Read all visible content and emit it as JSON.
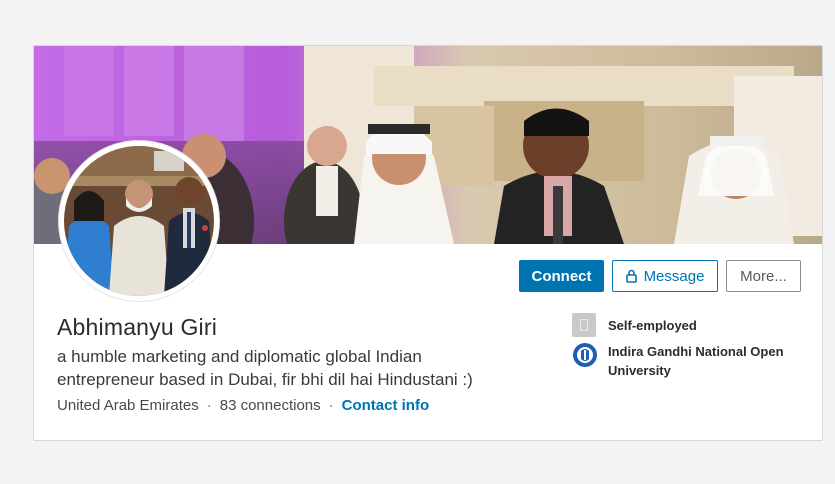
{
  "profile": {
    "name": "Abhimanyu Giri",
    "headline": "a humble marketing and diplomatic global Indian entrepreneur based in Dubai, fir bhi dil hai Hindustani :)",
    "location": "United Arab Emirates",
    "connections": "83 connections",
    "contact_label": "Contact info"
  },
  "actions": {
    "connect": "Connect",
    "message": "Message",
    "more": "More..."
  },
  "experience": {
    "current": "Self-employed",
    "education": "Indira Gandhi National Open University"
  },
  "separators": {
    "dot": "·"
  },
  "colors": {
    "brand": "#0073b1",
    "page_bg": "#f3f3f3",
    "card_bg": "#ffffff",
    "cover_purple": "#b15fd6"
  },
  "icons": {
    "message": "lock-icon",
    "experience": "company-icon",
    "education": "university-logo-icon"
  }
}
